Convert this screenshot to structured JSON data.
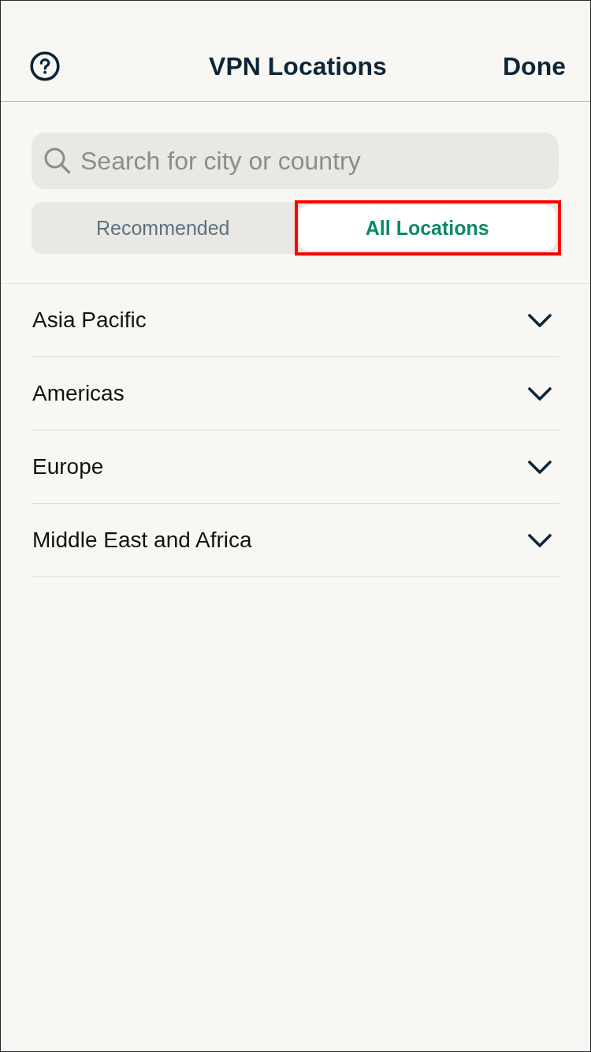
{
  "header": {
    "title": "VPN Locations",
    "done_button": "Done"
  },
  "search": {
    "placeholder": "Search for city or country"
  },
  "tabs": [
    {
      "label": "Recommended",
      "selected": false,
      "highlighted": false
    },
    {
      "label": "All Locations",
      "selected": true,
      "highlighted": true
    }
  ],
  "regions": [
    {
      "name": "Asia Pacific",
      "expanded": false
    },
    {
      "name": "Americas",
      "expanded": false
    },
    {
      "name": "Europe",
      "expanded": false
    },
    {
      "name": "Middle East and Africa",
      "expanded": false
    }
  ]
}
